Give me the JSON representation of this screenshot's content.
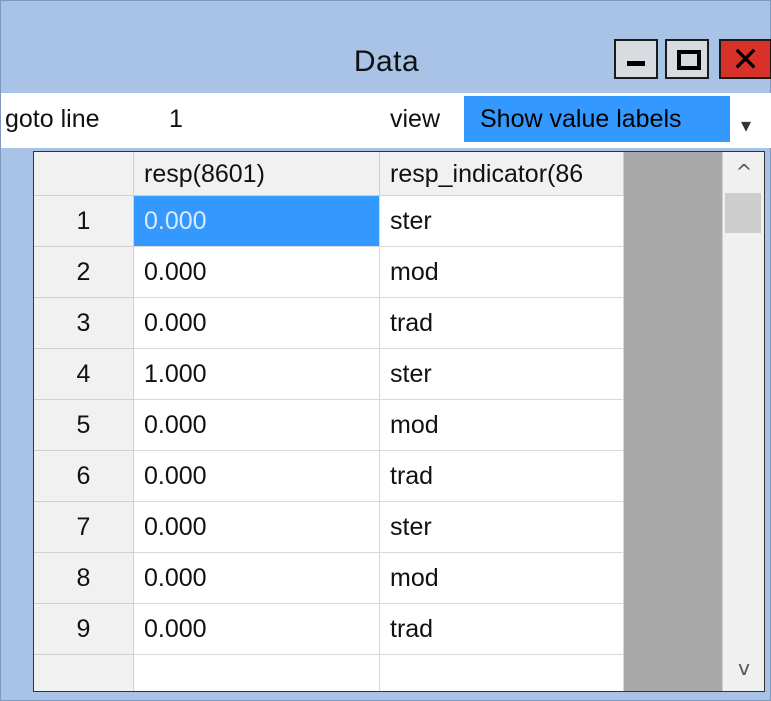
{
  "window": {
    "title": "Data",
    "minimize_glyph": "",
    "close_glyph": "✕"
  },
  "toolbar": {
    "goto_label": "goto line",
    "goto_value": "1",
    "view_label": "view",
    "view_selected": "Show value labels",
    "dropdown_icon": "▾"
  },
  "grid": {
    "columns": [
      "resp(8601)",
      "resp_indicator(86"
    ],
    "rows": [
      {
        "num": "1",
        "resp": "0.000",
        "indicator": "ster"
      },
      {
        "num": "2",
        "resp": "0.000",
        "indicator": "mod"
      },
      {
        "num": "3",
        "resp": "0.000",
        "indicator": "trad"
      },
      {
        "num": "4",
        "resp": "1.000",
        "indicator": "ster"
      },
      {
        "num": "5",
        "resp": "0.000",
        "indicator": "mod"
      },
      {
        "num": "6",
        "resp": "0.000",
        "indicator": "trad"
      },
      {
        "num": "7",
        "resp": "0.000",
        "indicator": "ster"
      },
      {
        "num": "8",
        "resp": "0.000",
        "indicator": "mod"
      },
      {
        "num": "9",
        "resp": "0.000",
        "indicator": "trad"
      }
    ],
    "selected_cell": {
      "row": 1,
      "column": "resp(8601)"
    }
  },
  "scrollbar": {
    "up_arrow": "^",
    "down_arrow": "v"
  },
  "colors": {
    "window_frame": "#a9c3e6",
    "selection": "#3399ff",
    "close_button": "#d8312a"
  }
}
